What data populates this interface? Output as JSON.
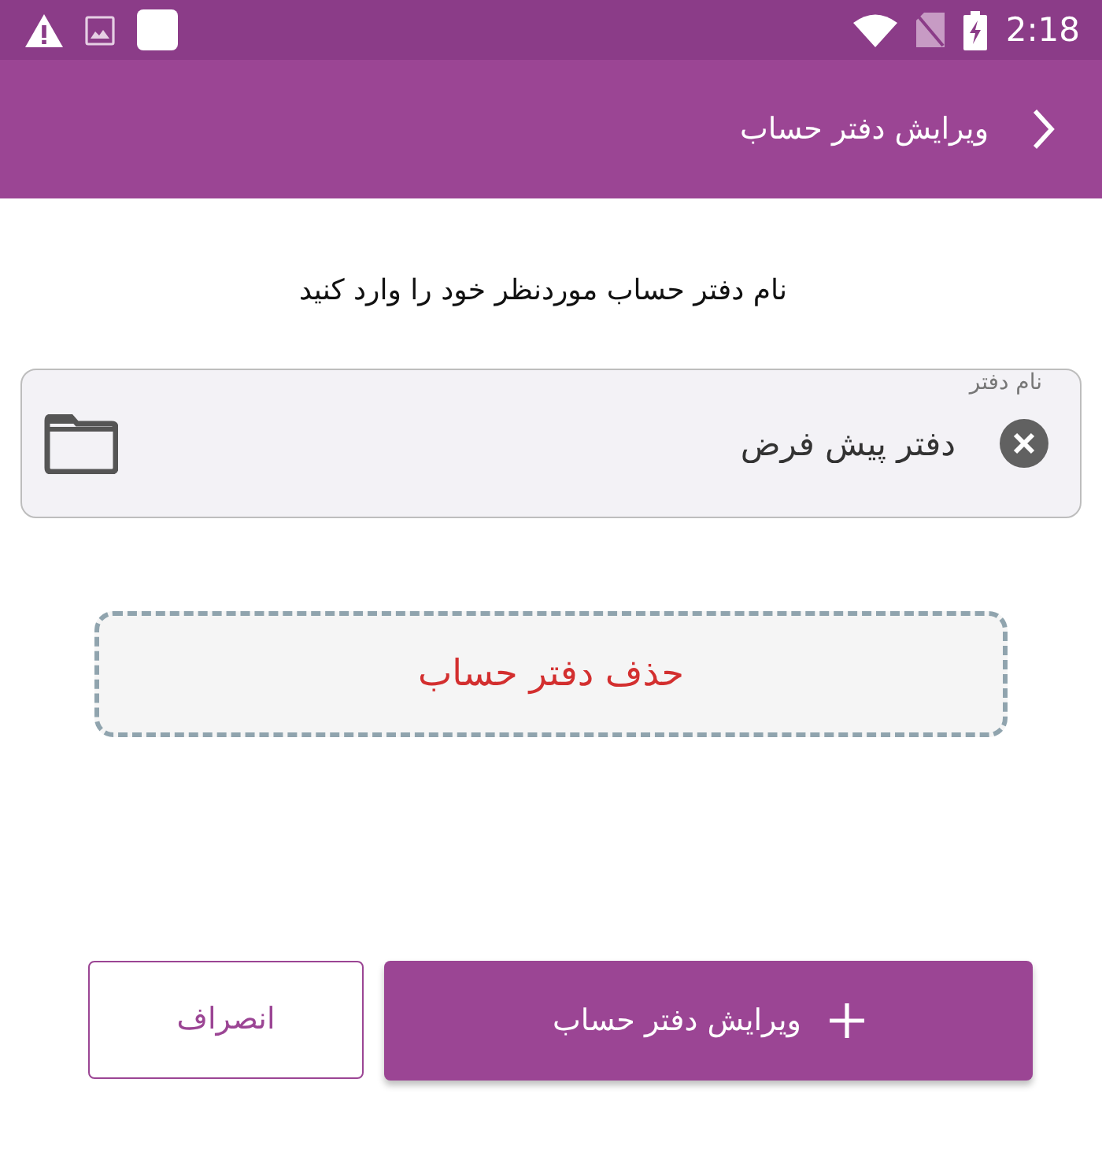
{
  "status_bar": {
    "time": "2:18"
  },
  "app_bar": {
    "title": "ویرایش دفتر حساب"
  },
  "instruction": "نام دفتر حساب موردنظر خود را وارد کنید",
  "name_field": {
    "label": "نام دفتر",
    "value": "دفتر پیش فرض"
  },
  "delete_button": {
    "label": "حذف دفتر حساب"
  },
  "buttons": [
    {
      "kind": "primary",
      "label": "ویرایش دفتر حساب"
    },
    {
      "kind": "outline",
      "label": "انصراف"
    }
  ]
}
